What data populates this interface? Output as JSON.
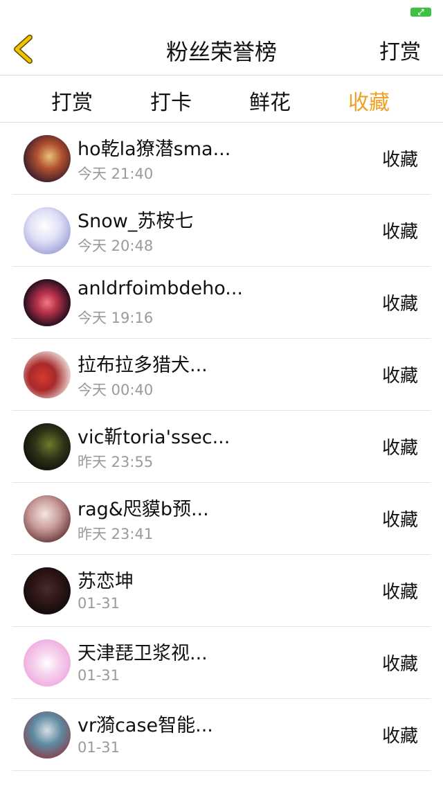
{
  "navbar": {
    "title": "粉丝荣誉榜",
    "right_label": "打赏",
    "back_icon": "chevron-left-icon",
    "back_color": "#f2c200"
  },
  "status_bar": {
    "battery_color": "#3ec142",
    "battery_glyph": "⤢"
  },
  "tabs": [
    {
      "label": "打赏",
      "active": false
    },
    {
      "label": "打卡",
      "active": false
    },
    {
      "label": "鲜花",
      "active": false
    },
    {
      "label": "收藏",
      "active": true
    }
  ],
  "active_tab_color": "#f2a024",
  "fans": [
    {
      "name": "ho乾la獠潜sma...",
      "time": "今天 21:40",
      "action": "收藏"
    },
    {
      "name": "Snow_苏桉七",
      "time": "今天 20:48",
      "action": "收藏"
    },
    {
      "name": "anldrfoimbdeho...",
      "time": "今天 19:16",
      "action": "收藏"
    },
    {
      "name": "拉布拉多猎犬...",
      "time": "今天 00:40",
      "action": "收藏"
    },
    {
      "name": "vic靳toria'ssec...",
      "time": "昨天 23:55",
      "action": "收藏"
    },
    {
      "name": "rag&咫貘b预...",
      "time": "昨天 23:41",
      "action": "收藏"
    },
    {
      "name": "苏恋坤",
      "time": "01-31",
      "action": "收藏"
    },
    {
      "name": "天津琵卫浆视...",
      "time": "01-31",
      "action": "收藏"
    },
    {
      "name": "vr漪case智能...",
      "time": "01-31",
      "action": "收藏"
    }
  ]
}
